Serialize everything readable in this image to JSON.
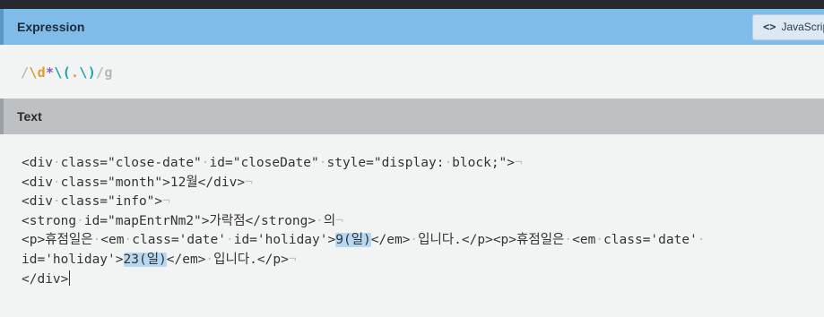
{
  "expression": {
    "title": "Expression",
    "flavor_label": "JavaScript",
    "pattern": {
      "open_delim": "/",
      "escape": "\\d",
      "quantifier": "*",
      "paren_open": "\\(",
      "dot": ".",
      "paren_close": "\\)",
      "close_delim": "/",
      "flags": "g"
    }
  },
  "text": {
    "title": "Text",
    "lines": [
      "<div·class=\"close-date\"·id=\"closeDate\"·style=\"display:·block;\">",
      "<div·class=\"month\">12월</div>",
      "<div·class=\"info\">",
      "<strong·id=\"mapEntrNm2\">가락점</strong>·의",
      "<p>휴점일은·<em·class='date'·id='holiday'>",
      "9(일)",
      "</em>·입니다.</p><p>휴점일은·<em·class='date'·",
      "id='holiday'>",
      "23(일)",
      "</em>·입니다.</p>",
      "</div>"
    ]
  },
  "colors": {
    "expression_header": "#7fbce9",
    "text_header": "#bdc1c3",
    "match_highlight": "#b6d8f2"
  }
}
